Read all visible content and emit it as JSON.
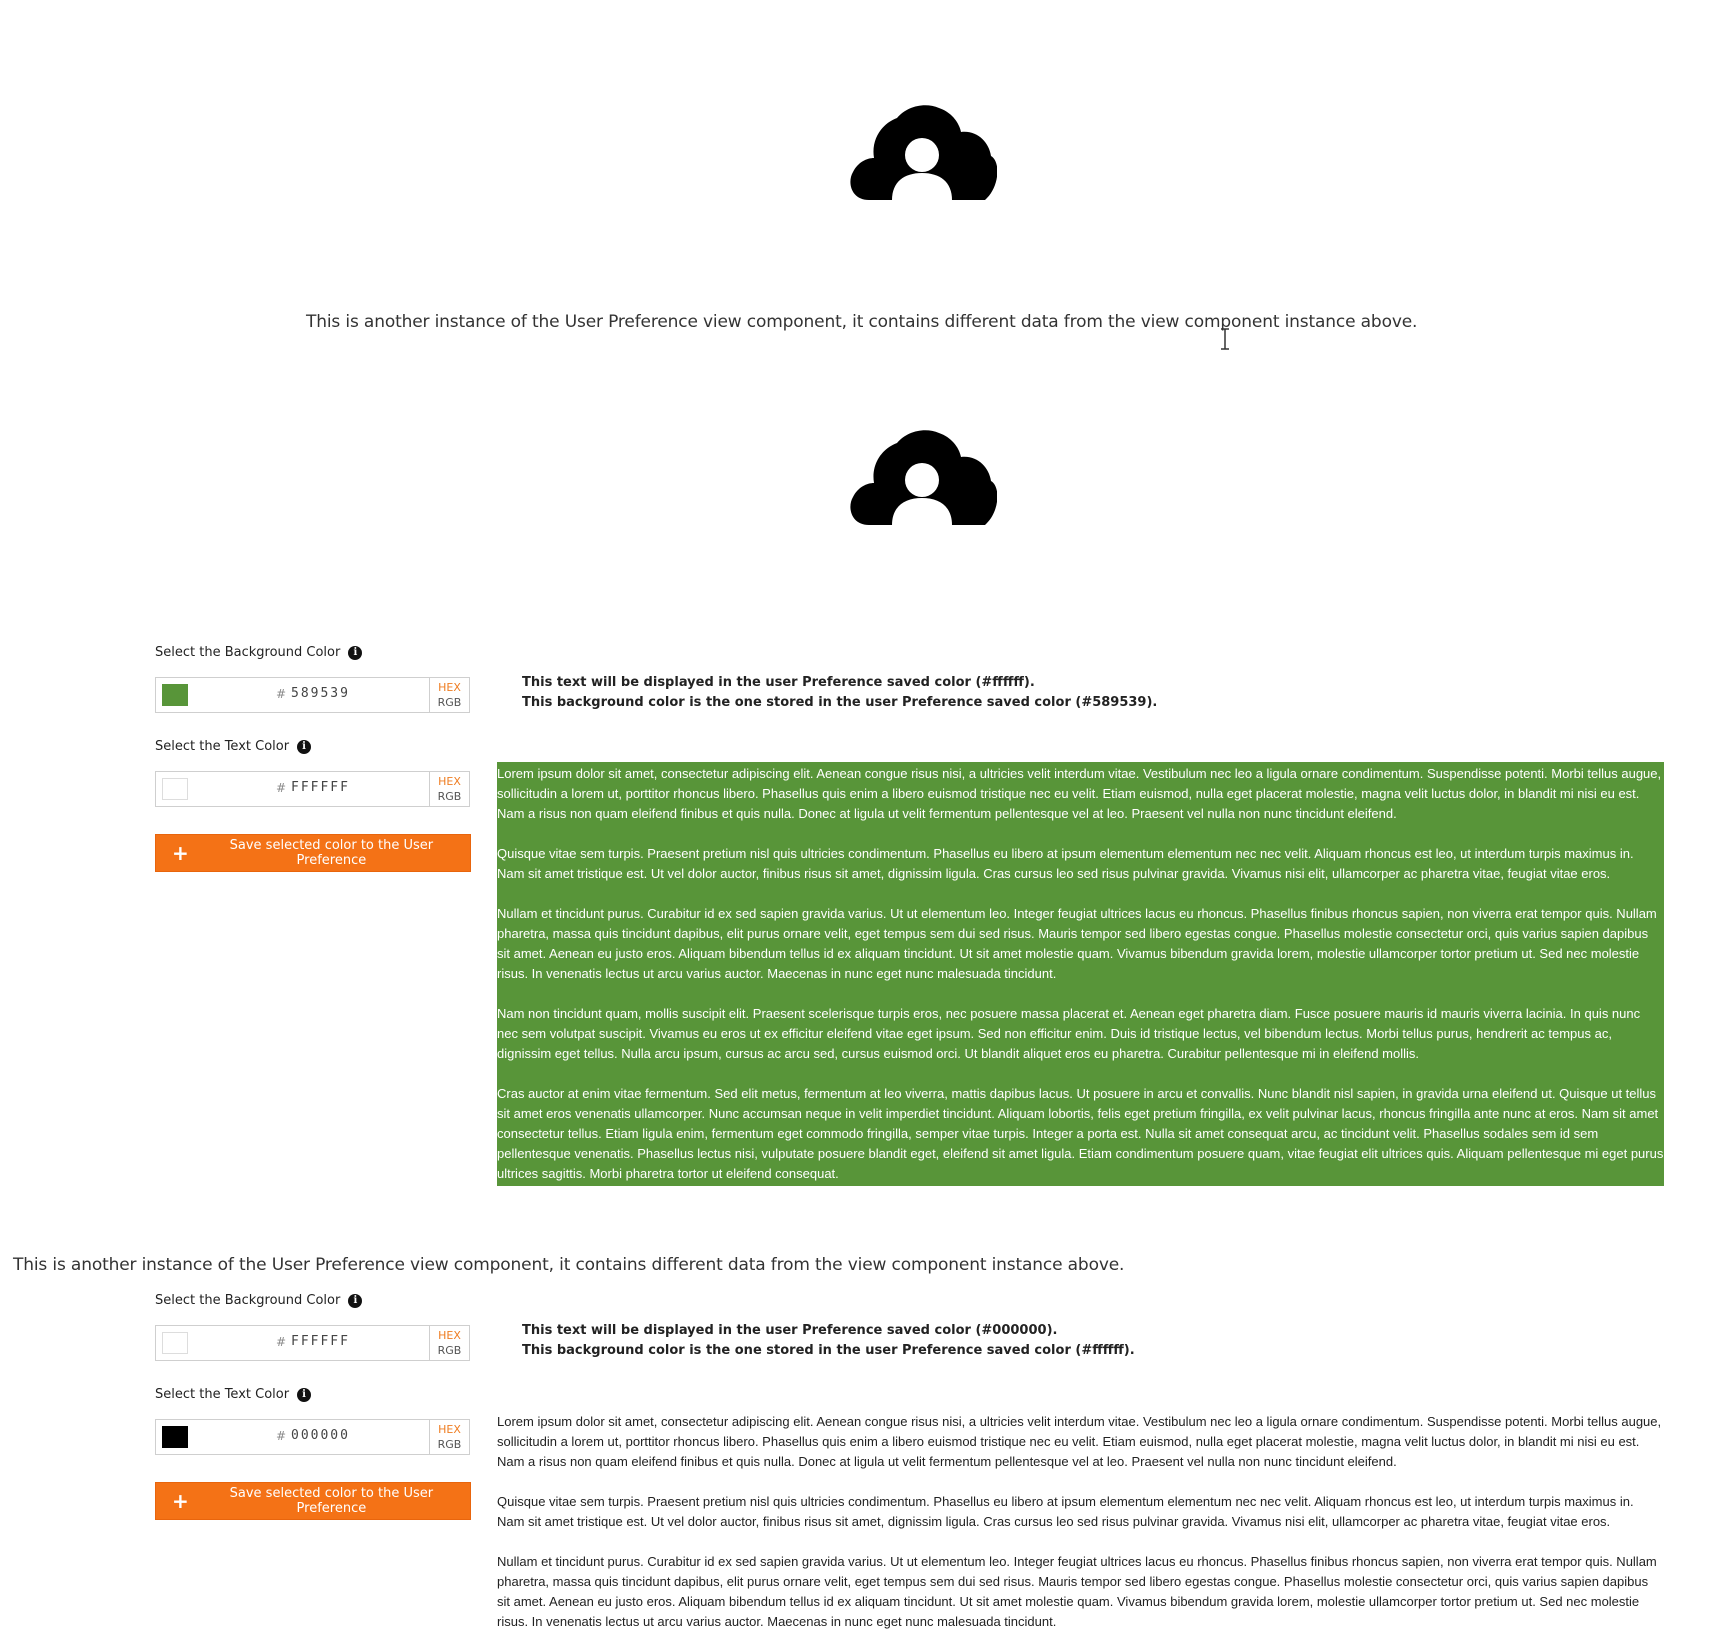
{
  "intro_text_1": "This is another instance of the User Preference view component, it contains different data from the view component instance above.",
  "intro_text_2": "This is another instance of the User Preference view component, it contains different data from the view component instance above.",
  "icons": {
    "avatar": "cloud-user-icon",
    "info": "info-icon",
    "plus": "plus-icon",
    "cursor": "text-cursor-icon"
  },
  "instances": [
    {
      "bg_label": "Select the Background Color",
      "bg_hex": "589539",
      "bg_color": "#589539",
      "text_label": "Select the Text Color",
      "text_hex": "FFFFFF",
      "text_color": "#ffffff",
      "mode_hex": "HEX",
      "mode_rgb": "RGB",
      "save_label": "Save selected color to the User Preference",
      "info_line_1": "This text will be displayed in the user Preference saved color (#ffffff).",
      "info_line_2": "This background color is the one stored in the user Preference saved color (#589539).",
      "paragraphs": [
        "Lorem ipsum dolor sit amet, consectetur adipiscing elit. Aenean congue risus nisi, a ultricies velit interdum vitae. Vestibulum nec leo a ligula ornare condimentum. Suspendisse potenti. Morbi tellus augue, sollicitudin a lorem ut, porttitor rhoncus libero. Phasellus quis enim a libero euismod tristique nec eu velit. Etiam euismod, nulla eget placerat molestie, magna velit luctus dolor, in blandit mi nisi eu est. Nam a risus non quam eleifend finibus et quis nulla. Donec at ligula ut velit fermentum pellentesque vel at leo. Praesent vel nulla non nunc tincidunt eleifend.",
        "Quisque vitae sem turpis. Praesent pretium nisl quis ultricies condimentum. Phasellus eu libero at ipsum elementum elementum nec nec velit. Aliquam rhoncus est leo, ut interdum turpis maximus in. Nam sit amet tristique est. Ut vel dolor auctor, finibus risus sit amet, dignissim ligula. Cras cursus leo sed risus pulvinar gravida. Vivamus nisi elit, ullamcorper ac pharetra vitae, feugiat vitae eros.",
        "Nullam et tincidunt purus. Curabitur id ex sed sapien gravida varius. Ut ut elementum leo. Integer feugiat ultrices lacus eu rhoncus. Phasellus finibus rhoncus sapien, non viverra erat tempor quis. Nullam pharetra, massa quis tincidunt dapibus, elit purus ornare velit, eget tempus sem dui sed risus. Mauris tempor sed libero egestas congue. Phasellus molestie consectetur orci, quis varius sapien dapibus sit amet. Aenean eu justo eros. Aliquam bibendum tellus id ex aliquam tincidunt. Ut sit amet molestie quam. Vivamus bibendum gravida lorem, molestie ullamcorper tortor pretium ut. Sed nec molestie risus. In venenatis lectus ut arcu varius auctor. Maecenas in nunc eget nunc malesuada tincidunt.",
        "Nam non tincidunt quam, mollis suscipit elit. Praesent scelerisque turpis eros, nec posuere massa placerat et. Aenean eget pharetra diam. Fusce posuere mauris id mauris viverra lacinia. In quis nunc nec sem volutpat suscipit. Vivamus eu eros ut ex efficitur eleifend vitae eget ipsum. Sed non efficitur enim. Duis id tristique lectus, vel bibendum lectus. Morbi tellus purus, hendrerit ac tempus ac, dignissim eget tellus. Nulla arcu ipsum, cursus ac arcu sed, cursus euismod orci. Ut blandit aliquet eros eu pharetra. Curabitur pellentesque mi in eleifend mollis.",
        "Cras auctor at enim vitae fermentum. Sed elit metus, fermentum at leo viverra, mattis dapibus lacus. Ut posuere in arcu et convallis. Nunc blandit nisl sapien, in gravida urna eleifend ut. Quisque ut tellus sit amet eros venenatis ullamcorper. Nunc accumsan neque in velit imperdiet tincidunt. Aliquam lobortis, felis eget pretium fringilla, ex velit pulvinar lacus, rhoncus fringilla ante nunc at eros. Nam sit amet consectetur tellus. Etiam ligula enim, fermentum eget commodo fringilla, semper vitae turpis. Integer a porta est. Nulla sit amet consequat arcu, ac tincidunt velit. Phasellus sodales sem id sem pellentesque venenatis. Phasellus lectus nisi, vulputate posuere blandit eget, eleifend sit amet ligula. Etiam condimentum posuere quam, vitae feugiat elit ultrices quis. Aliquam pellentesque mi eget purus ultrices sagittis. Morbi pharetra tortor ut eleifend consequat."
      ]
    },
    {
      "bg_label": "Select the Background Color",
      "bg_hex": "FFFFFF",
      "bg_color": "#ffffff",
      "text_label": "Select the Text Color",
      "text_hex": "000000",
      "text_color": "#000000",
      "mode_hex": "HEX",
      "mode_rgb": "RGB",
      "save_label": "Save selected color to the User Preference",
      "info_line_1": "This text will be displayed in the user Preference saved color (#000000).",
      "info_line_2": "This background color is the one stored in the user Preference saved color (#ffffff).",
      "paragraphs": [
        "Lorem ipsum dolor sit amet, consectetur adipiscing elit. Aenean congue risus nisi, a ultricies velit interdum vitae. Vestibulum nec leo a ligula ornare condimentum. Suspendisse potenti. Morbi tellus augue, sollicitudin a lorem ut, porttitor rhoncus libero. Phasellus quis enim a libero euismod tristique nec eu velit. Etiam euismod, nulla eget placerat molestie, magna velit luctus dolor, in blandit mi nisi eu est. Nam a risus non quam eleifend finibus et quis nulla. Donec at ligula ut velit fermentum pellentesque vel at leo. Praesent vel nulla non nunc tincidunt eleifend.",
        "Quisque vitae sem turpis. Praesent pretium nisl quis ultricies condimentum. Phasellus eu libero at ipsum elementum elementum nec nec velit. Aliquam rhoncus est leo, ut interdum turpis maximus in. Nam sit amet tristique est. Ut vel dolor auctor, finibus risus sit amet, dignissim ligula. Cras cursus leo sed risus pulvinar gravida. Vivamus nisi elit, ullamcorper ac pharetra vitae, feugiat vitae eros.",
        "Nullam et tincidunt purus. Curabitur id ex sed sapien gravida varius. Ut ut elementum leo. Integer feugiat ultrices lacus eu rhoncus. Phasellus finibus rhoncus sapien, non viverra erat tempor quis. Nullam pharetra, massa quis tincidunt dapibus, elit purus ornare velit, eget tempus sem dui sed risus. Mauris tempor sed libero egestas congue. Phasellus molestie consectetur orci, quis varius sapien dapibus sit amet. Aenean eu justo eros. Aliquam bibendum tellus id ex aliquam tincidunt. Ut sit amet molestie quam. Vivamus bibendum gravida lorem, molestie ullamcorper tortor pretium ut. Sed nec molestie risus. In venenatis lectus ut arcu varius auctor. Maecenas in nunc eget nunc malesuada tincidunt."
      ]
    }
  ]
}
